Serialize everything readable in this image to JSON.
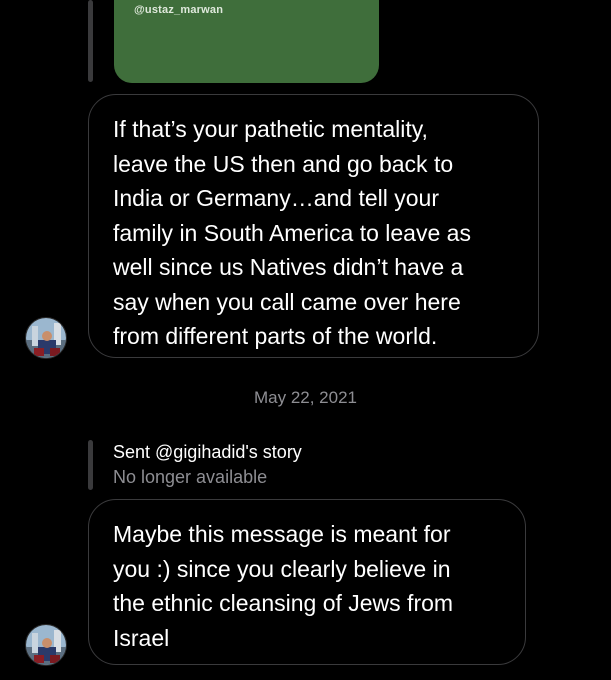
{
  "shared_post": {
    "handle": "@ustaz_marwan",
    "card_color": "#3f6e3b"
  },
  "messages": [
    {
      "text": "If that’s your pathetic mentality,\nleave the US then and go back to\nIndia or Germany…and tell your\nfamily in South America to leave as\nwell since us Natives didn’t have a\nsay when you call came over here\nfrom different parts of the world."
    },
    {
      "text": "Maybe this message is meant for\nyou :) since you clearly believe in\nthe ethnic cleansing of Jews from\nIsrael"
    }
  ],
  "date_divider": "May 22, 2021",
  "story_reply": {
    "title": "Sent @gigihadid's story",
    "status": "No longer available"
  },
  "colors": {
    "background": "#000000",
    "bubble_border": "#3a3a3c",
    "muted_text": "#8e8e93"
  },
  "icons": {
    "avatar": "profile-photo-avatar"
  }
}
